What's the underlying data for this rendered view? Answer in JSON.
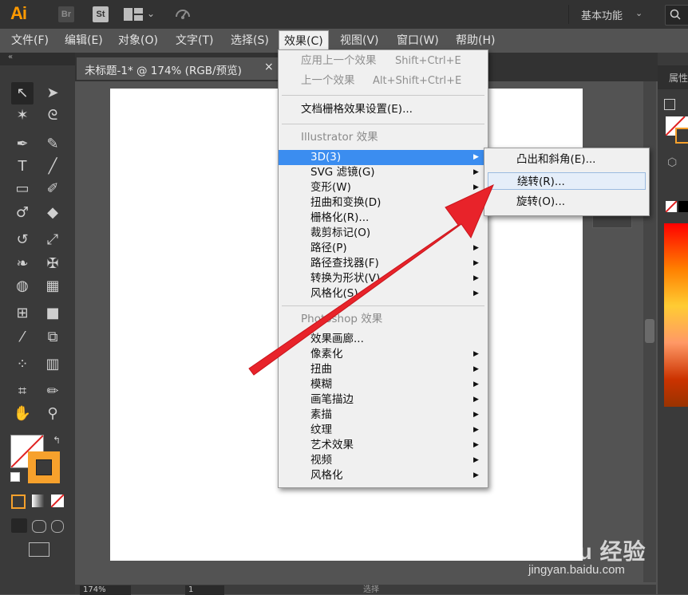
{
  "app": {
    "logo_text": "Ai",
    "br_label": "Br",
    "st_label": "St",
    "workspace_label": "基本功能"
  },
  "menubar": {
    "items": [
      "文件(F)",
      "编辑(E)",
      "对象(O)",
      "文字(T)",
      "选择(S)",
      "效果(C)",
      "视图(V)",
      "窗口(W)",
      "帮助(H)"
    ],
    "active_index": 5
  },
  "document_tab": {
    "label": "未标题-1* @ 174% (RGB/预览)",
    "close_glyph": "×"
  },
  "status_bar": {
    "zoom": "174%",
    "page": "1",
    "mode": "选择"
  },
  "right_panel": {
    "title": "属性"
  },
  "effect_menu": {
    "apply_last": "应用上一个效果",
    "apply_last_shortcut": "Shift+Ctrl+E",
    "last_effect": "上一个效果",
    "last_effect_shortcut": "Alt+Shift+Ctrl+E",
    "raster_settings": "文档栅格效果设置(E)...",
    "illustrator_section": "Illustrator 效果",
    "illustrator_items": [
      "3D(3)",
      "SVG 滤镜(G)",
      "变形(W)",
      "扭曲和变换(D)",
      "栅格化(R)...",
      "裁剪标记(O)",
      "路径(P)",
      "路径查找器(F)",
      "转换为形状(V)",
      "风格化(S)"
    ],
    "photoshop_section": "Photoshop 效果",
    "photoshop_items": [
      "效果画廊...",
      "像素化",
      "扭曲",
      "模糊",
      "画笔描边",
      "素描",
      "纹理",
      "艺术效果",
      "视频",
      "风格化"
    ]
  },
  "submenu_3d": {
    "items": [
      "凸出和斜角(E)...",
      "绕转(R)...",
      "旋转(O)..."
    ],
    "hover_index": 1
  },
  "colors": {
    "accent_orange": "#ff9a00",
    "menu_highlight": "#3b8df0",
    "annotation_arrow": "#e8232a"
  },
  "watermark": {
    "logo": "Baidu 经验",
    "url": "jingyan.baidu.com"
  }
}
